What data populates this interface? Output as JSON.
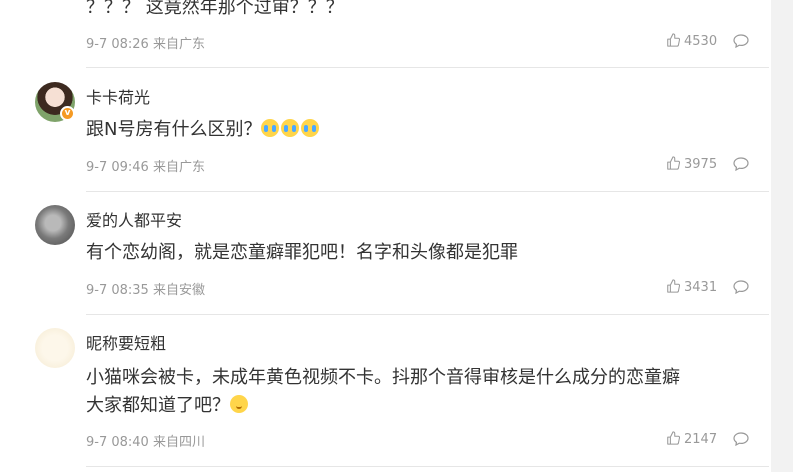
{
  "comments": [
    {
      "content": "？？？ 这竟然年那个过审？？？",
      "time": "9-7 08:26",
      "source": "来自广东",
      "likes": "4530"
    },
    {
      "username": "卡卡荷光",
      "content": "跟N号房有什么区别？",
      "emojis": [
        "crying-face-icon",
        "crying-face-icon",
        "crying-face-icon"
      ],
      "time": "9-7 09:46",
      "source": "来自广东",
      "likes": "3975",
      "verified": true
    },
    {
      "username": "爱的人都平安",
      "content": "有个恋幼阁，就是恋童癖罪犯吧！名字和头像都是犯罪",
      "time": "9-7 08:35",
      "source": "来自安徽",
      "likes": "3431"
    },
    {
      "username": "昵称要短粗",
      "content_line1": "小猫咪会被卡，未成年黄色视频不卡。抖那个音得审核是什么成分的恋童癖",
      "content_line2": "大家都知道了吧？",
      "emojis": [
        "thinking-face-icon"
      ],
      "time": "9-7 08:40",
      "source": "来自四川",
      "likes": "2147"
    }
  ],
  "colors": {
    "text": "#333333",
    "meta": "#999999",
    "divider": "#e6e6e6",
    "verified_badge": "#f59a23"
  }
}
